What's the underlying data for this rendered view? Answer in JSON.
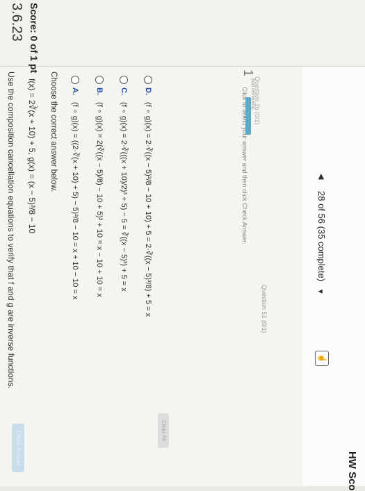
{
  "header": {
    "app_label": "HW Sco",
    "question_counter": "28 of 56 (35 complete)",
    "prev_arrow": "◀",
    "dropdown_caret": "▼"
  },
  "sidebar": {
    "score": "Score: 0 of 1 pt",
    "question_id": "3.6.23"
  },
  "question": {
    "instruction": "Use the composition cancellation equations to verify that f and g are inverse functions.",
    "given": "f(x) = 2∛(x + 10) + 5,   g(x) = (x − 5)³/8 − 10",
    "prompt": "Choose the correct answer below."
  },
  "options": [
    {
      "letter": "A.",
      "text": "(f ∘ g)(x) = ((2·∛(x + 10) + 5) − 5)³/8 − 10 = x + 10 − 10 = x"
    },
    {
      "letter": "B.",
      "text": "(f ∘ g)(x) = 2(∛((x − 5)/8) − 10 + 5)³ + 10 = x − 10 + 10 = x"
    },
    {
      "letter": "C.",
      "text": "(f ∘ g)(x) = 2·∛(((x + 10)/2)³ + 5) − 5 = ∛((x − 5)³) + 5 = x"
    },
    {
      "letter": "D.",
      "text": "(f ∘ g)(x) = 2·∛((x − 5)³/8 − 10 + 10) + 5 = 2·∛((x − 5)³/8) + 5 = x"
    }
  ],
  "footer": {
    "hint": "Click to select your answer and then click Check Answer.",
    "progress_number": "1",
    "progress_label": "part remaining",
    "progress_fraction": 1,
    "parts_label": "Question 1b (0/1)",
    "question_status": "Question 51 (0/1)",
    "clear_all": "Clear All",
    "check_answer": "Check Answer"
  }
}
